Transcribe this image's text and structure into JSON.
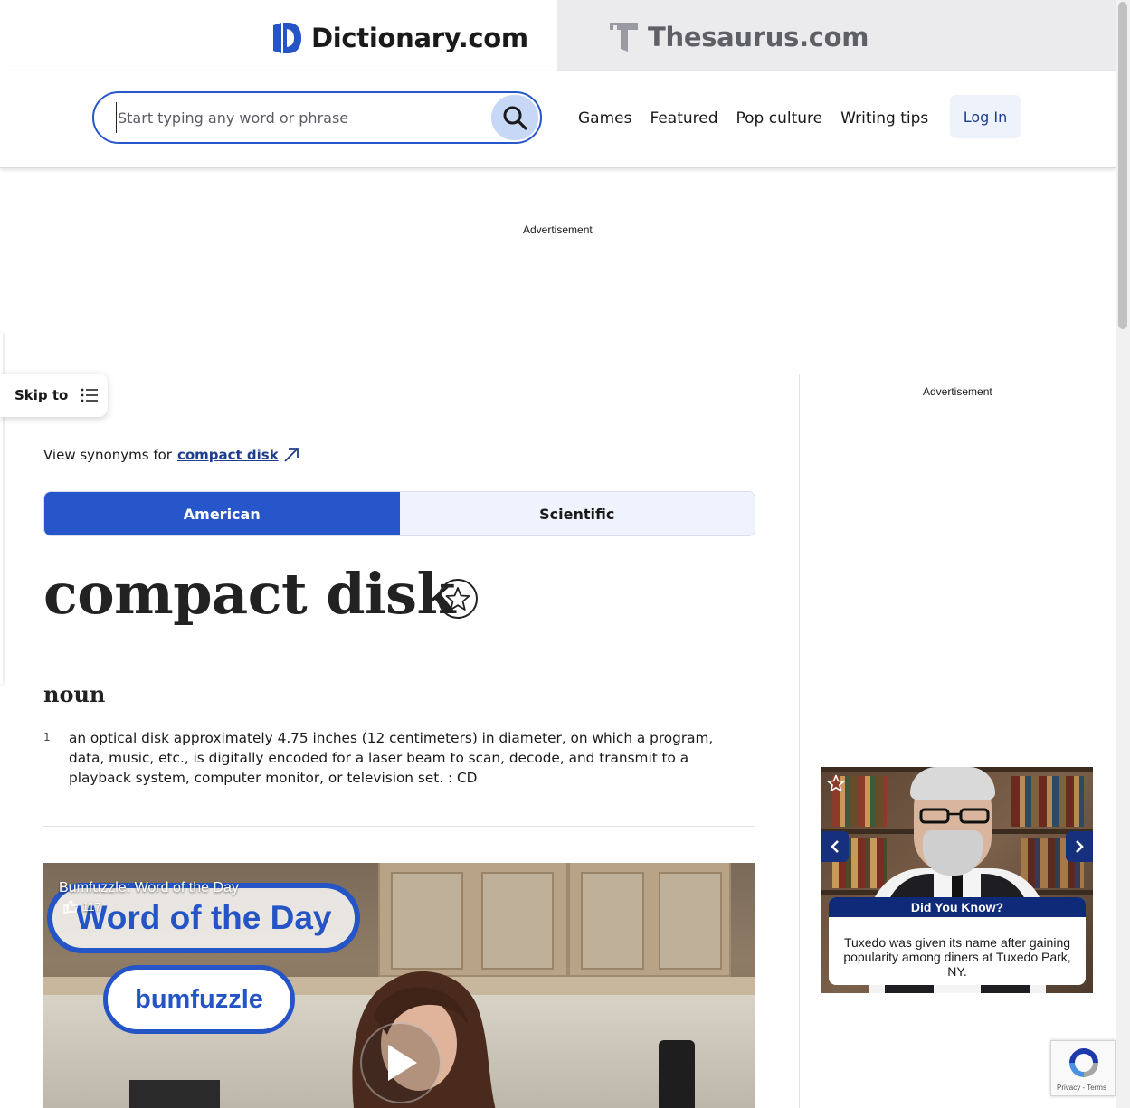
{
  "brands": {
    "dictionary": "Dictionary.com",
    "thesaurus": "Thesaurus.com"
  },
  "search": {
    "placeholder": "Start typing any word or phrase"
  },
  "nav": {
    "items": [
      "Games",
      "Featured",
      "Pop culture",
      "Writing tips"
    ],
    "login": "Log In"
  },
  "ads": {
    "top_label": "Advertisement",
    "side_label": "Advertisement"
  },
  "skip": {
    "label": "Skip to"
  },
  "entry": {
    "synonyms_prefix": "View synonyms for",
    "synonyms_link": "compact disk",
    "tabs": [
      {
        "label": "American",
        "active": true
      },
      {
        "label": "Scientific",
        "active": false
      }
    ],
    "headword": "compact disk",
    "part_of_speech": "noun",
    "definitions": [
      {
        "number": "1",
        "text": "an optical disk approximately 4.75 inches (12 centimeters) in diameter, on which a program, data, music, etc., is digitally encoded for a laser beam to scan, decode, and transmit to a playback system, computer monitor, or television set. : CD"
      }
    ]
  },
  "video": {
    "title": "Bumfuzzle: Word of the Day",
    "likes": "117",
    "overlay_title": "Word of the Day",
    "overlay_word": "bumfuzzle"
  },
  "widget": {
    "heading": "Did You Know?",
    "text": "Tuxedo was given its name after gaining popularity among diners at Tuxedo Park, NY."
  },
  "recaptcha": {
    "terms": "Privacy - Terms"
  },
  "colors": {
    "brand_blue": "#2656c9",
    "link_blue": "#1f3d8f",
    "tab_inactive_bg": "#eef3fd",
    "thesaurus_tab_bg": "#ebebee"
  }
}
